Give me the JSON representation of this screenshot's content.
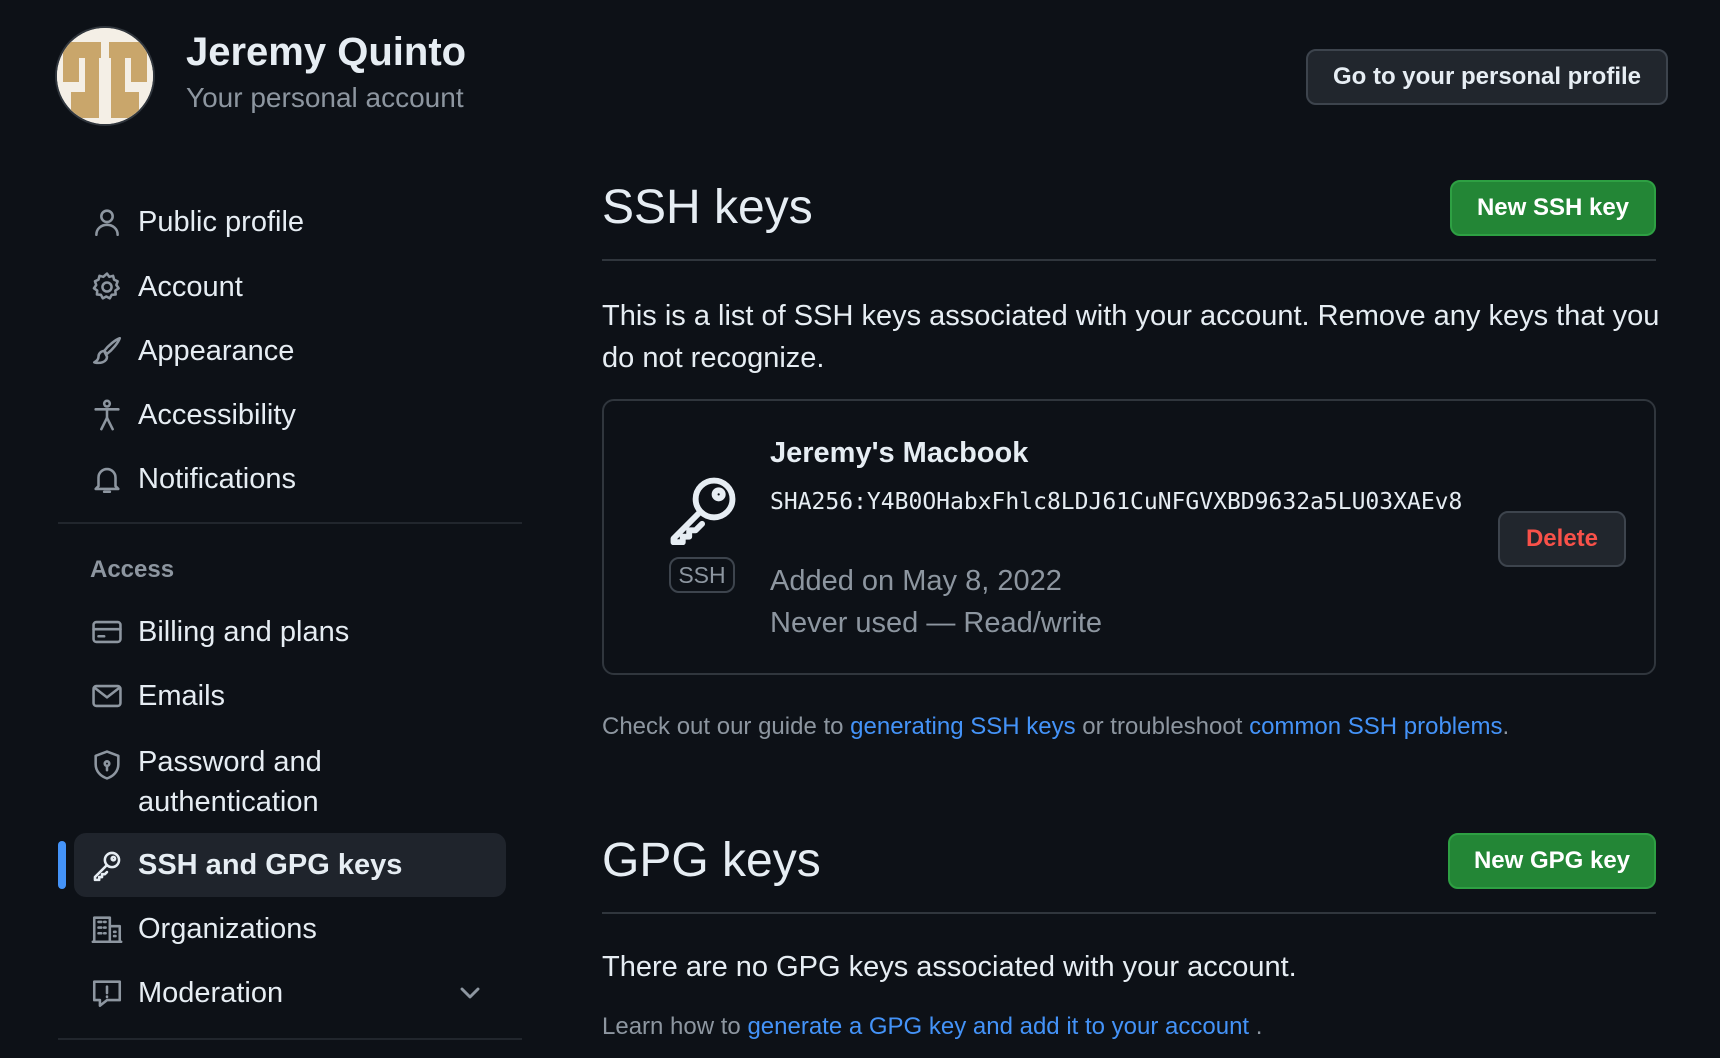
{
  "account": {
    "name": "Jeremy Quinto",
    "subtitle": "Your personal account",
    "profile_button": "Go to your personal profile"
  },
  "sidebar": {
    "items": [
      {
        "label": "Public profile",
        "icon": "person-icon"
      },
      {
        "label": "Account",
        "icon": "gear-icon"
      },
      {
        "label": "Appearance",
        "icon": "paintbrush-icon"
      },
      {
        "label": "Accessibility",
        "icon": "accessibility-icon"
      },
      {
        "label": "Notifications",
        "icon": "bell-icon"
      }
    ],
    "access_heading": "Access",
    "access_items": [
      {
        "label": "Billing and plans",
        "icon": "credit-card-icon"
      },
      {
        "label": "Emails",
        "icon": "mail-icon"
      },
      {
        "label": "Password and authentication",
        "icon": "shield-lock-icon"
      },
      {
        "label": "SSH and GPG keys",
        "icon": "key-icon",
        "active": true
      },
      {
        "label": "Organizations",
        "icon": "organization-icon"
      },
      {
        "label": "Moderation",
        "icon": "report-icon",
        "expandable": true
      }
    ]
  },
  "ssh": {
    "title": "SSH keys",
    "new_button": "New SSH key",
    "description": "This is a list of SSH keys associated with your account. Remove any keys that you do not recognize.",
    "keys": [
      {
        "title": "Jeremy's Macbook",
        "type_label": "SSH",
        "fingerprint": "SHA256:Y4B0OHabxFhlc8LDJ61CuNFGVXBD9632a5LU03XAEv8",
        "added": "Added on May 8, 2022",
        "usage": "Never used — Read/write",
        "delete_label": "Delete"
      }
    ],
    "help_prefix": "Check out our guide to ",
    "help_link1": "generating SSH keys",
    "help_middle": " or troubleshoot ",
    "help_link2": "common SSH problems",
    "help_suffix": "."
  },
  "gpg": {
    "title": "GPG keys",
    "new_button": "New GPG key",
    "empty_text": "There are no GPG keys associated with your account.",
    "help_prefix": "Learn how to ",
    "help_link": "generate a GPG key and add it to your account",
    "help_suffix": " ."
  },
  "colors": {
    "background": "#0d1117",
    "accent": "#4493f8",
    "primary_button": "#238636",
    "danger": "#f85149"
  }
}
